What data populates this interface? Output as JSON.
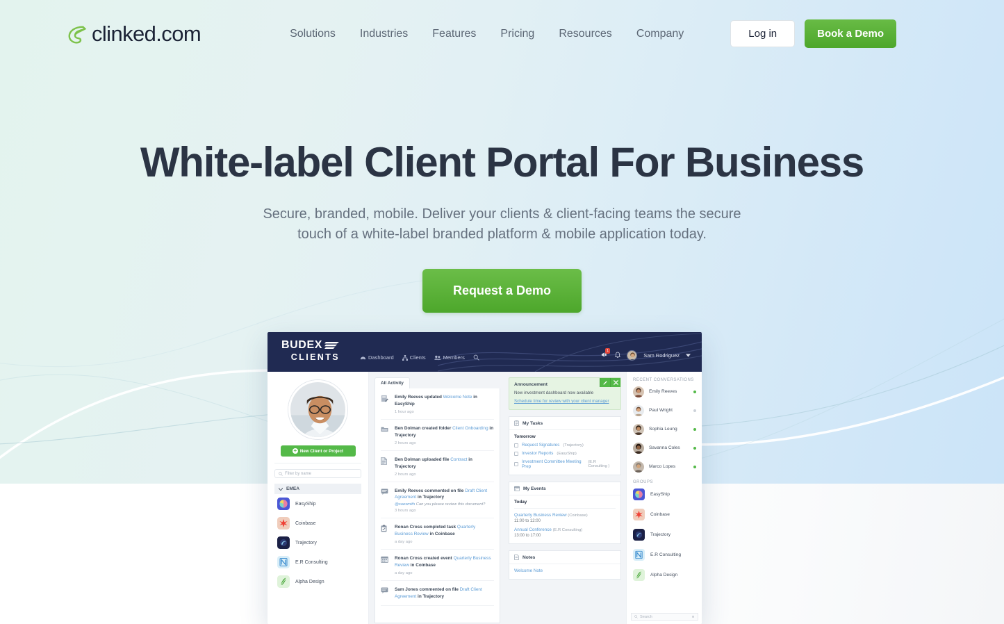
{
  "site": {
    "logo_text": "clinked.com",
    "nav": [
      {
        "label": "Solutions"
      },
      {
        "label": "Industries"
      },
      {
        "label": "Features"
      },
      {
        "label": "Pricing"
      },
      {
        "label": "Resources"
      },
      {
        "label": "Company"
      }
    ],
    "login_label": "Log in",
    "demo_label": "Book a Demo"
  },
  "hero": {
    "title": "White-label Client Portal For Business",
    "subtitle_line1": "Secure, branded, mobile. Deliver your clients & client-facing teams the secure",
    "subtitle_line2": "touch of a white-label branded platform & mobile application today.",
    "cta_label": "Request a Demo"
  },
  "colors": {
    "brand_green": "#54b948",
    "cta_green": "#4da72b",
    "app_navy": "#202a52",
    "link_blue": "#5b9bd5",
    "heading": "#2b3444"
  },
  "app": {
    "brand_line1": "BUDEX",
    "brand_line2": "CLIENTS",
    "nav": [
      {
        "label": "Dashboard",
        "icon": "dashboard-icon"
      },
      {
        "label": "Clients",
        "icon": "clients-icon"
      },
      {
        "label": "Members",
        "icon": "members-icon"
      }
    ],
    "search_icon": "search-icon",
    "announce_icon": "megaphone-icon",
    "message_badge": "1",
    "bell_icon": "bell-icon",
    "user_name": "Sam Rodriguez",
    "sidebar": {
      "new_client_label": "New Client or Project",
      "filter_placeholder": "Filter by name",
      "group_label": "EMEA",
      "clients": [
        {
          "name": "EasyShip"
        },
        {
          "name": "Coinbase"
        },
        {
          "name": "Trajectory"
        },
        {
          "name": "E.R Consulting"
        },
        {
          "name": "Alpha Design"
        }
      ]
    },
    "activity": {
      "tab_label": "All Activity",
      "items": [
        {
          "icon": "note-edit-icon",
          "actor": "Emily Reeves",
          "verb": "updated",
          "object": "Welcome Note",
          "tail": "in EasyShip",
          "quote": "",
          "mention": "",
          "time": "1 hour ago"
        },
        {
          "icon": "folder-icon",
          "actor": "Ben Dolman",
          "verb": "created folder",
          "object": "Client Onboarding",
          "tail": "in Trajectory",
          "quote": "",
          "mention": "",
          "time": "2 hours ago"
        },
        {
          "icon": "file-icon",
          "actor": "Ben Dolman",
          "verb": "uploaded file",
          "object": "Contract",
          "tail": "in Trajectory",
          "quote": "",
          "mention": "",
          "time": "2 hours ago"
        },
        {
          "icon": "comment-icon",
          "actor": "Emily Reeves",
          "verb": "commented on file",
          "object": "Draft Client Agreement",
          "tail": "in Trajectory",
          "mention": "@suesmith",
          "quote": "Can you please review this document?",
          "time": "3 hours ago"
        },
        {
          "icon": "task-icon",
          "actor": "Ronan Cross",
          "verb": "completed task",
          "object": "Quarterly Business Review",
          "tail": "in Coinbase",
          "quote": "",
          "mention": "",
          "time": "a day ago"
        },
        {
          "icon": "calendar-icon",
          "actor": "Ronan Cross",
          "verb": "created event",
          "object": "Quarterly Business Review",
          "tail": "in Coinbase",
          "quote": "",
          "mention": "",
          "time": "a day ago"
        },
        {
          "icon": "comment-icon",
          "actor": "Sam Jones",
          "verb": "commented on file",
          "object": "Draft Client Agreement",
          "tail": "in Trajectory",
          "quote": "",
          "mention": "",
          "time": ""
        }
      ]
    },
    "announcement": {
      "title": "Announcement",
      "body": "New investment dashboard now available",
      "link": "Schedule time for review with your client manager",
      "edit_icon": "pencil-icon",
      "close_icon": "close-icon"
    },
    "tasks": {
      "title": "My Tasks",
      "icon": "clipboard-icon",
      "day": "Tomorrow",
      "items": [
        {
          "name": "Request Signatures",
          "group": "(Trajectory)"
        },
        {
          "name": "Investor Reports",
          "group": "(EasyShip)"
        },
        {
          "name": "Investment Committee Meeting Prep",
          "group": "(E.R Consulting )"
        }
      ]
    },
    "events": {
      "title": "My Events",
      "icon": "calendar-icon",
      "day": "Today",
      "items": [
        {
          "name": "Quarterly Business Review",
          "group": "(Coinbase)",
          "time": "11:00 to 12:00"
        },
        {
          "name": "Annual Conference",
          "group": "(E.R Consulting)",
          "time": "13:00 to 17:00"
        }
      ]
    },
    "notes": {
      "title": "Notes",
      "icon": "note-icon",
      "items": [
        {
          "name": "Welcome Note"
        }
      ]
    },
    "conversations": {
      "title": "RECENT CONVERSATIONS",
      "items": [
        {
          "name": "Emily Reeves",
          "status": "online"
        },
        {
          "name": "Paul Wright",
          "status": "offline"
        },
        {
          "name": "Sophia Leung",
          "status": "online"
        },
        {
          "name": "Savanna Coles",
          "status": "online"
        },
        {
          "name": "Marco Lopes",
          "status": "online"
        }
      ]
    },
    "groups": {
      "title": "GROUPS",
      "items": [
        {
          "name": "EasyShip"
        },
        {
          "name": "Coinbase"
        },
        {
          "name": "Trajectory"
        },
        {
          "name": "E.R Consulting"
        },
        {
          "name": "Alpha Design"
        }
      ],
      "search_placeholder": "Search"
    }
  }
}
